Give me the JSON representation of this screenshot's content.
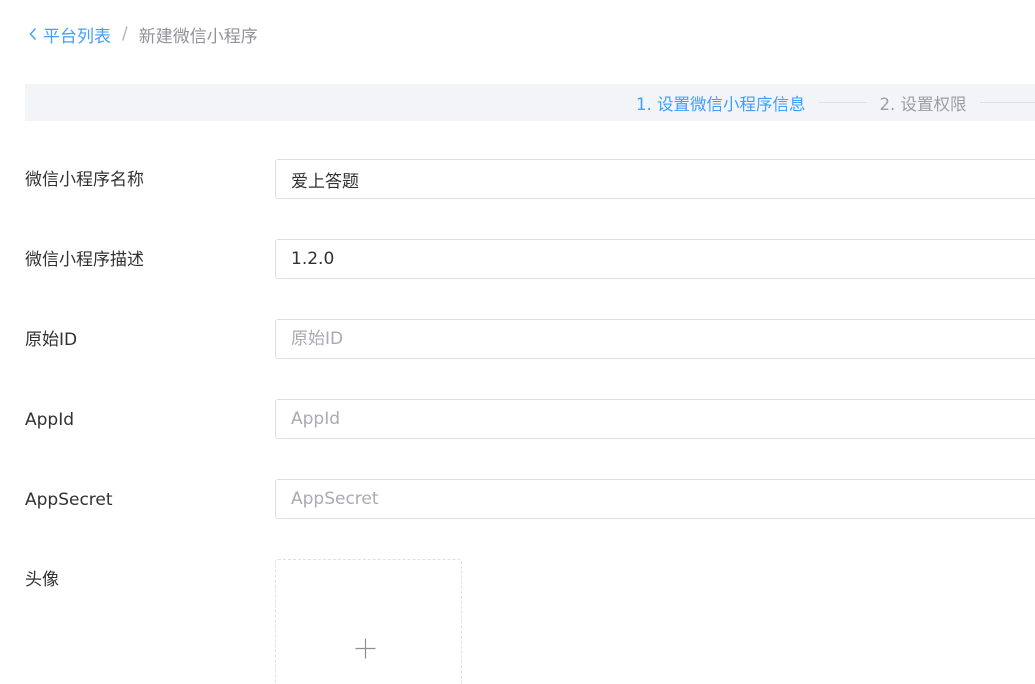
{
  "breadcrumb": {
    "back_label": "平台列表",
    "separator": "/",
    "current": "新建微信小程序"
  },
  "steps": [
    {
      "label": "1. 设置微信小程序信息",
      "state": "active"
    },
    {
      "label": "2. 设置权限",
      "state": "inactive"
    }
  ],
  "form": {
    "name": {
      "label": "微信小程序名称",
      "value": "爱上答题",
      "placeholder": ""
    },
    "description": {
      "label": "微信小程序描述",
      "value": "1.2.0",
      "placeholder": ""
    },
    "original_id": {
      "label": "原始ID",
      "value": "",
      "placeholder": "原始ID"
    },
    "appid": {
      "label": "AppId",
      "value": "",
      "placeholder": "AppId"
    },
    "appsecret": {
      "label": "AppSecret",
      "value": "",
      "placeholder": "AppSecret"
    },
    "avatar": {
      "label": "头像"
    }
  },
  "colors": {
    "accent": "#409eff",
    "steps_bg": "#f3f4f7",
    "border": "#dcdfe6",
    "placeholder": "#a8abb2"
  },
  "icons": {
    "back": "chevron-left-icon",
    "upload": "plus-icon"
  }
}
